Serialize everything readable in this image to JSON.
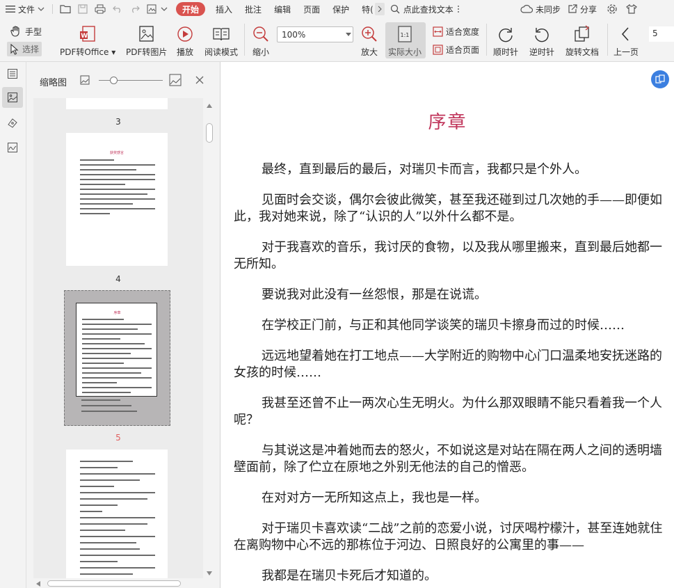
{
  "menu": {
    "file_label": "文件",
    "tabs": [
      "开始",
      "插入",
      "批注",
      "编辑",
      "页面",
      "保护",
      "特("
    ],
    "search_label": "点此查找文本",
    "sync_label": "未同步",
    "share_label": "分享"
  },
  "toolbar": {
    "hand_label": "手型",
    "select_label": "选择",
    "pdf_to_office_label": "PDF转Office",
    "pdf_to_image_label": "PDF转图片",
    "play_label": "播放",
    "read_mode_label": "阅读模式",
    "zoom_out_label": "缩小",
    "zoom_value": "100%",
    "zoom_in_label": "放大",
    "actual_size_label": "实际大小",
    "fit_width_label": "适合宽度",
    "fit_page_label": "适合页面",
    "rotate_cw_label": "顺时针",
    "rotate_ccw_label": "逆时针",
    "rotate_doc_label": "旋转文档",
    "prev_page_label": "上一页",
    "page_input_value": "5"
  },
  "panel": {
    "title": "缩略图",
    "pages": [
      {
        "number": "3"
      },
      {
        "number": "4",
        "title": "获奖感言"
      },
      {
        "number": "5",
        "title": "序章",
        "active": true
      }
    ]
  },
  "document": {
    "title": "序章",
    "paragraphs": [
      "最终，直到最后的最后，对瑞贝卡而言，我都只是个外人。",
      "见面时会交谈，偶尔会彼此微笑，甚至我还碰到过几次她的手——即便如此，我对她来说，除了“认识的人”以外什么都不是。",
      "对于我喜欢的音乐，我讨厌的食物，以及我从哪里搬来，直到最后她都一无所知。",
      "要说我对此没有一丝怨恨，那是在说谎。",
      "在学校正门前，与正和其他同学谈笑的瑞贝卡擦身而过的时候……",
      "远远地望着她在打工地点——大学附近的购物中心门口温柔地安抚迷路的女孩的时候……",
      "我甚至还曾不止一两次心生无明火。为什么那双眼睛不能只看着我一个人呢？",
      "与其说这是冲着她而去的怒火，不如说这是对站在隔在两人之间的透明墙壁面前，除了伫立在原地之外别无他法的自己的憎恶。",
      "在对对方一无所知这点上，我也是一样。",
      "对于瑞贝卡喜欢读“二战”之前的恋爱小说，讨厌喝柠檬汁，甚至连她就住在离购物中心不远的那栋位于河边、日照良好的公寓里的事——",
      "我都是在瑞贝卡死后才知道的。"
    ]
  },
  "colors": {
    "accent_tab": "#d9534f",
    "title_red": "#c0345a",
    "float_blue": "#3b7fe0"
  }
}
